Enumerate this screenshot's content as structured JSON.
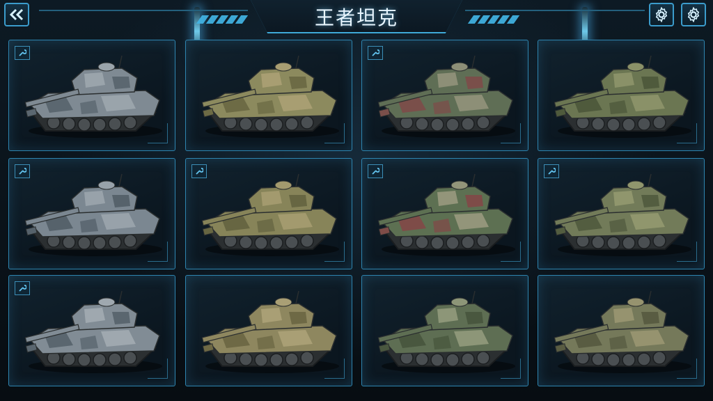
{
  "header": {
    "title": "王者坦克",
    "back_icon": "double-chevron-left-icon",
    "settings_icon": "gear-icon"
  },
  "colors": {
    "accent": "#3fa9d8",
    "card_border": "#2e85b0",
    "background": "#0b141c"
  },
  "tanks": [
    {
      "camo": "steel-grey",
      "base": "#7f8a93",
      "patch1": "#5b6770",
      "patch2": "#9aa4ab",
      "badge": true
    },
    {
      "camo": "desert-olive",
      "base": "#8c8a5e",
      "patch1": "#6d6b45",
      "patch2": "#a89e72",
      "badge": false
    },
    {
      "camo": "woodland-red",
      "base": "#5f6e55",
      "patch1": "#7a4f4a",
      "patch2": "#8d8f77",
      "badge": true
    },
    {
      "camo": "olive-green",
      "base": "#6b7652",
      "patch1": "#4f5a3c",
      "patch2": "#8a9168",
      "badge": false
    },
    {
      "camo": "steel-grey",
      "base": "#7b8791",
      "patch1": "#56626b",
      "patch2": "#98a2aa",
      "badge": true
    },
    {
      "camo": "desert-olive",
      "base": "#878459",
      "patch1": "#676642",
      "patch2": "#a39a6e",
      "badge": true
    },
    {
      "camo": "woodland-red",
      "base": "#5d7052",
      "patch1": "#7e4c48",
      "patch2": "#93957a",
      "badge": true
    },
    {
      "camo": "olive-green",
      "base": "#727b59",
      "patch1": "#535d40",
      "patch2": "#90966d",
      "badge": true
    },
    {
      "camo": "steel-grey",
      "base": "#818c95",
      "patch1": "#5a666f",
      "patch2": "#9fa8af",
      "badge": true
    },
    {
      "camo": "desert-olive",
      "base": "#8e875f",
      "patch1": "#6e6945",
      "patch2": "#a99f75",
      "badge": false
    },
    {
      "camo": "woodland-green",
      "base": "#5e6e53",
      "patch1": "#49573f",
      "patch2": "#8d9678",
      "badge": false
    },
    {
      "camo": "olive-green",
      "base": "#75795a",
      "patch1": "#595c42",
      "patch2": "#96936f",
      "badge": false
    }
  ]
}
